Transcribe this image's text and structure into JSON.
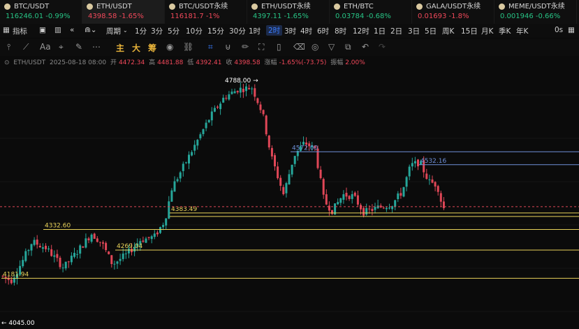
{
  "tickers": [
    {
      "symbol": "BTC/USDT",
      "price": "116246.01",
      "change": "-0.99%",
      "price_color": "green",
      "change_color": "green",
      "active": false
    },
    {
      "symbol": "ETH/USDT",
      "price": "4398.58",
      "change": "-1.65%",
      "price_color": "red",
      "change_color": "red",
      "active": true
    },
    {
      "symbol": "BTC/USDT永续",
      "price": "116181.7",
      "change": "-1%",
      "price_color": "red",
      "change_color": "red",
      "active": false
    },
    {
      "symbol": "ETH/USDT永续",
      "price": "4397.11",
      "change": "-1.65%",
      "price_color": "green",
      "change_color": "green",
      "active": false
    },
    {
      "symbol": "ETH/BTC",
      "price": "0.03784",
      "change": "-0.68%",
      "price_color": "green",
      "change_color": "green",
      "active": false
    },
    {
      "symbol": "GALA/USDT永续",
      "price": "0.01693",
      "change": "-1.8%",
      "price_color": "red",
      "change_color": "red",
      "active": false
    },
    {
      "symbol": "MEME/USDT永续",
      "price": "0.001946",
      "change": "-0.66%",
      "price_color": "green",
      "change_color": "green",
      "active": false
    }
  ],
  "timeframes": {
    "indicator_label": "指标",
    "period_label": "周期",
    "items": [
      "1分",
      "3分",
      "5分",
      "10分",
      "15分",
      "30分",
      "1时",
      "2时",
      "3时",
      "4时",
      "6时",
      "8时",
      "12时",
      "1日",
      "2日",
      "3日",
      "5日",
      "周K",
      "15日",
      "月K",
      "季K",
      "年K"
    ],
    "selected": "2时",
    "seconds_label": "0s"
  },
  "toolbar": {
    "text_tool": "Aa",
    "main_chars": [
      "主",
      "大",
      "筹"
    ]
  },
  "info": {
    "symbol": "ETH/USDT",
    "datetime": "2025-08-18 08:00",
    "open_label": "开",
    "open": "4472.34",
    "high_label": "高",
    "high": "4481.88",
    "low_label": "低",
    "low": "4392.41",
    "close": "4398.58",
    "change_label": "涨幅",
    "change": "-1.65%(-73.75)",
    "amp_label": "振幅",
    "amp": "2.00%"
  },
  "levels": [
    {
      "label": "4383.49",
      "price": 4383.49,
      "color": "#e8d25a",
      "type": "line"
    },
    {
      "label": "4332.60",
      "price": 4332.6,
      "color": "#e8d25a",
      "type": "line"
    },
    {
      "label": "4269.04",
      "price": 4269.04,
      "color": "#e8d25a",
      "type": "line"
    },
    {
      "label": "4181.94",
      "price": 4181.94,
      "color": "#e8d25a",
      "type": "line"
    },
    {
      "label": "4572.00",
      "price": 4572.0,
      "color": "#6e8fd8",
      "type": "line"
    },
    {
      "label": "4532.16",
      "price": 4532.16,
      "color": "#6e8fd8",
      "type": "line"
    }
  ],
  "chart_data": {
    "type": "candlestick",
    "y_range": [
      4045.0,
      4788.0
    ],
    "max_label": "4788.00",
    "min_label": "4045.00",
    "current_price": 4398.58,
    "candles_ohlc": []
  }
}
